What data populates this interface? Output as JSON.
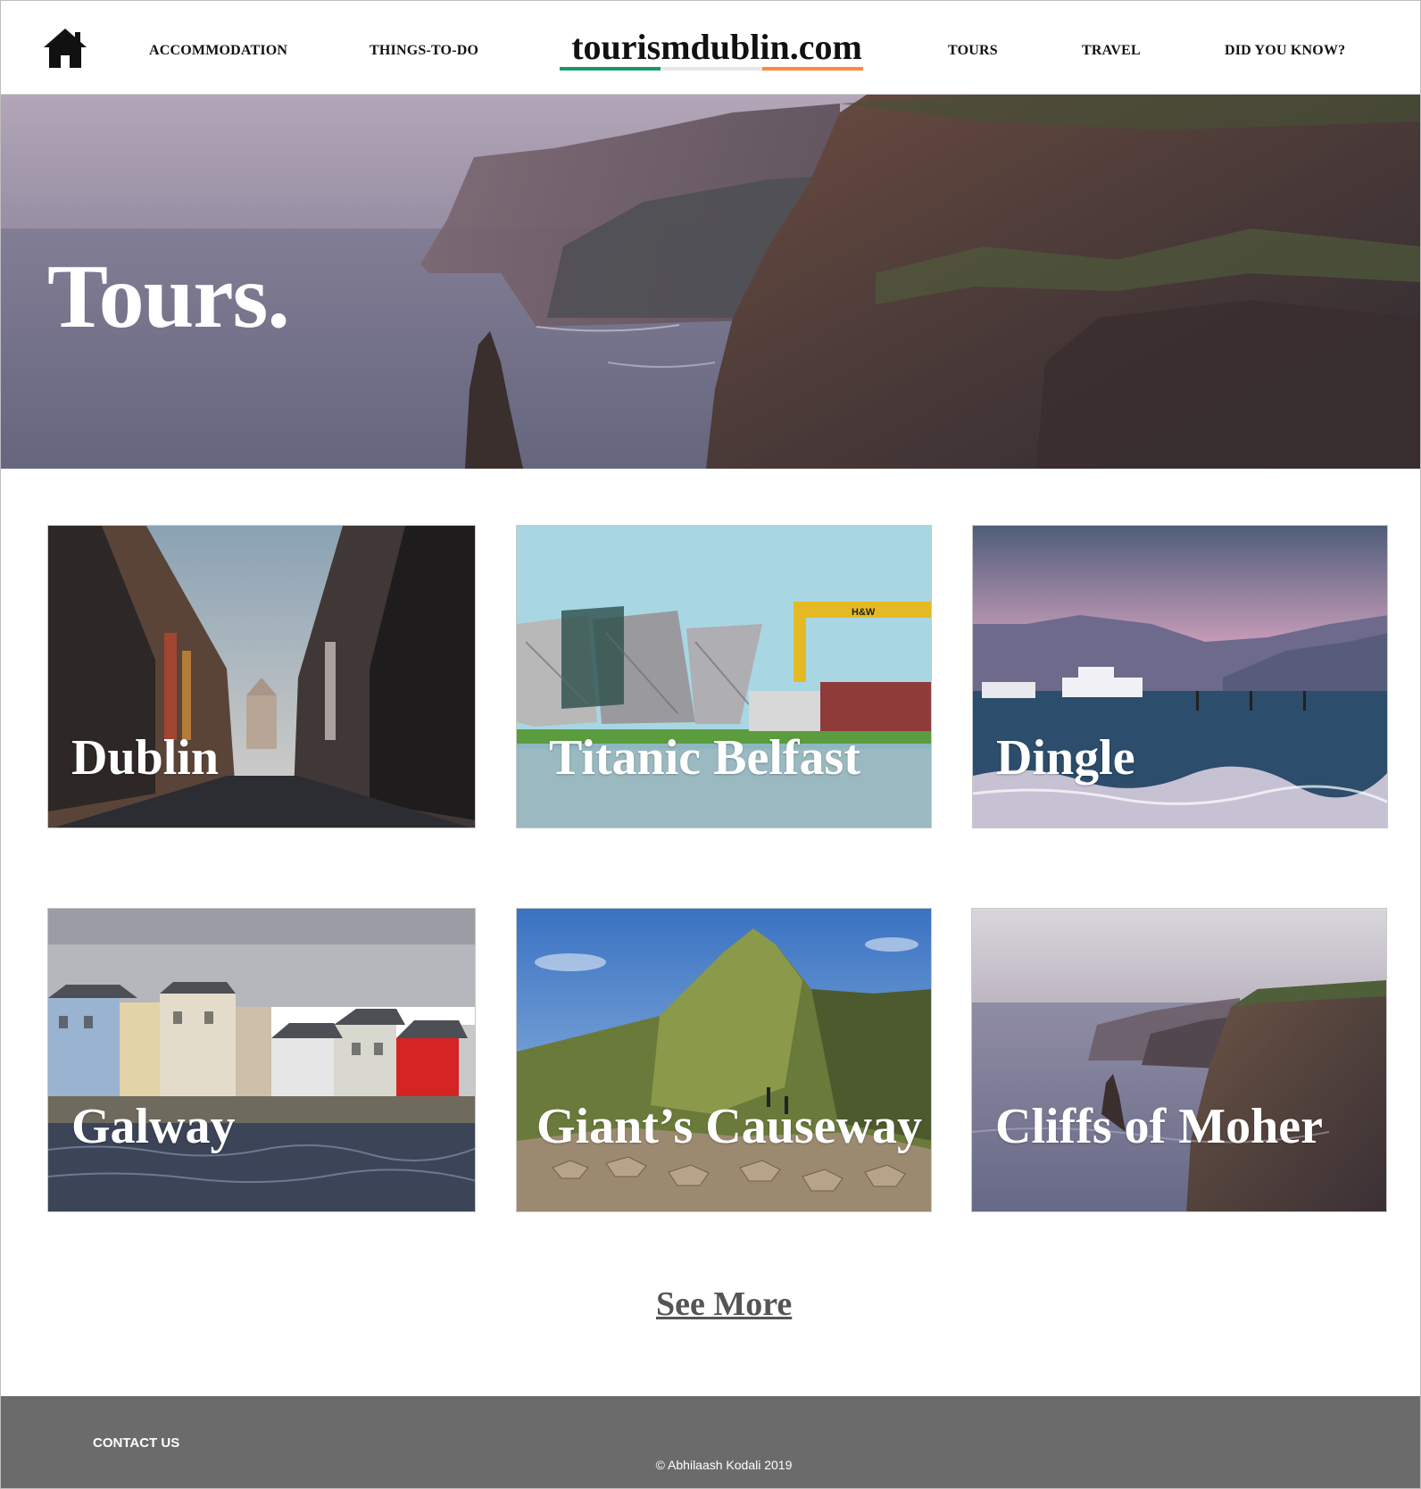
{
  "header": {
    "home_icon": "home-icon",
    "nav_left": [
      {
        "label": "ACCOMMODATION"
      },
      {
        "label": "THINGS-TO-DO"
      }
    ],
    "logo": "tourismdublin.com",
    "logo_bar_colors": [
      "#169b62",
      "#e6e6e6",
      "#ff883e"
    ],
    "nav_right": [
      {
        "label": "TOURS"
      },
      {
        "label": "TRAVEL"
      },
      {
        "label": "DID YOU KNOW?"
      }
    ]
  },
  "hero": {
    "title": "Tours."
  },
  "tours": [
    {
      "label": "Dublin"
    },
    {
      "label": "Titanic Belfast"
    },
    {
      "label": "Dingle"
    },
    {
      "label": "Galway"
    },
    {
      "label": "Giant’s Causeway"
    },
    {
      "label": "Cliffs of Moher"
    }
  ],
  "see_more": "See More",
  "footer": {
    "contact": "CONTACT US",
    "copyright": "© Abhilaash Kodali 2019",
    "background": "#6b6b6b"
  }
}
